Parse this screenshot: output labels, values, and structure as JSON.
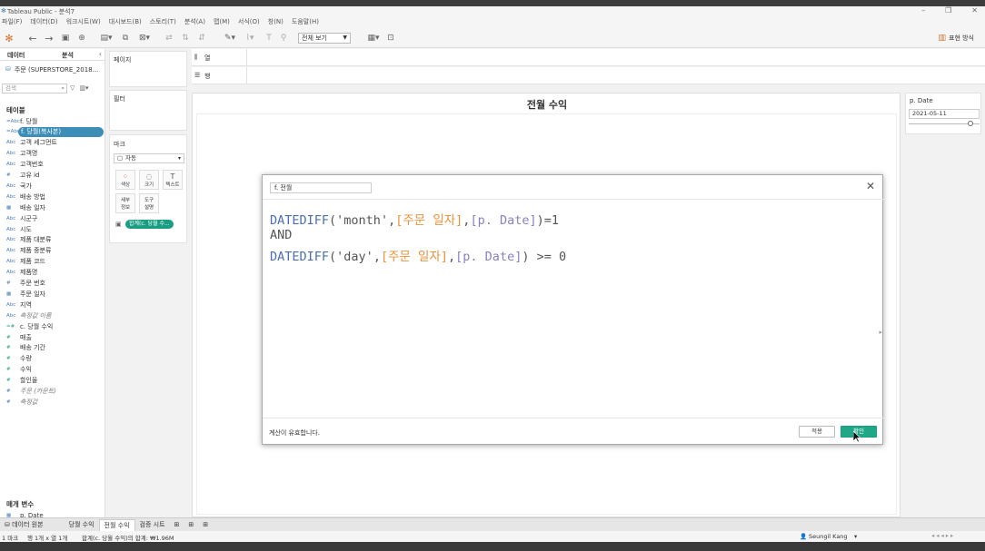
{
  "window": {
    "title": "Tableau Public - 분석7",
    "controls": [
      "–",
      "❐",
      "✕"
    ]
  },
  "menu": [
    "파일(F)",
    "데이터(D)",
    "워크시트(W)",
    "대시보드(B)",
    "스토리(T)",
    "분석(A)",
    "맵(M)",
    "서식(O)",
    "창(N)",
    "도움말(H)"
  ],
  "toolbar": {
    "view_select": "전체 보기",
    "present_label": "표현 방식"
  },
  "left_pane": {
    "tabs": [
      "데이터",
      "분석"
    ],
    "datasource": "주문 (SUPERSTORE_2018...",
    "search_placeholder": "검색",
    "tables_heading": "테이블",
    "fields": [
      {
        "type": "=Abc",
        "label": "f. 당월",
        "kind": "dim"
      },
      {
        "type": "=Abc",
        "label": "f. 당월(복사본)",
        "kind": "highlight"
      },
      {
        "type": "Abc",
        "label": "고객 세그먼트",
        "kind": "dim"
      },
      {
        "type": "Abc",
        "label": "고객명",
        "kind": "dim"
      },
      {
        "type": "Abc",
        "label": "고객번호",
        "kind": "dim"
      },
      {
        "type": "#",
        "label": "고유 id",
        "kind": "dim"
      },
      {
        "type": "Abc",
        "label": "국가",
        "kind": "dim"
      },
      {
        "type": "Abc",
        "label": "배송 방법",
        "kind": "dim"
      },
      {
        "type": "▦",
        "label": "배송 일자",
        "kind": "dim"
      },
      {
        "type": "Abc",
        "label": "시군구",
        "kind": "dim"
      },
      {
        "type": "Abc",
        "label": "시도",
        "kind": "dim"
      },
      {
        "type": "Abc",
        "label": "제품 대분류",
        "kind": "dim"
      },
      {
        "type": "Abc",
        "label": "제품 중분류",
        "kind": "dim"
      },
      {
        "type": "Abc",
        "label": "제품 코드",
        "kind": "dim"
      },
      {
        "type": "Abc",
        "label": "제품명",
        "kind": "dim"
      },
      {
        "type": "#",
        "label": "주문 번호",
        "kind": "dim"
      },
      {
        "type": "▦",
        "label": "주문 일자",
        "kind": "dim"
      },
      {
        "type": "Abc",
        "label": "지역",
        "kind": "dim"
      },
      {
        "type": "Abc",
        "label": "측정값 이름",
        "kind": "ital"
      },
      {
        "type": "=#",
        "label": "c. 당월 수익",
        "kind": "meas"
      },
      {
        "type": "#",
        "label": "매출",
        "kind": "meas"
      },
      {
        "type": "#",
        "label": "배송 기간",
        "kind": "meas"
      },
      {
        "type": "#",
        "label": "수량",
        "kind": "meas"
      },
      {
        "type": "#",
        "label": "수익",
        "kind": "meas"
      },
      {
        "type": "#",
        "label": "할인율",
        "kind": "meas"
      },
      {
        "type": "#",
        "label": "주문 (카운트)",
        "kind": "ital"
      },
      {
        "type": "#",
        "label": "측정값",
        "kind": "ital"
      }
    ],
    "params_heading": "매개 변수",
    "params": [
      {
        "type": "▦",
        "label": "p. Date"
      }
    ]
  },
  "cards": {
    "pages": "페이지",
    "filters": "필터",
    "marks": "마크",
    "marks_type": "자동",
    "mark_buttons": [
      {
        "icon": "⁘",
        "label": "색상"
      },
      {
        "icon": "◌",
        "label": "크기"
      },
      {
        "icon": "T",
        "label": "텍스트"
      },
      {
        "icon": "",
        "label": "세부\n정보"
      },
      {
        "icon": "",
        "label": "도구\n설명"
      }
    ],
    "mark_pill": "합계(c. 당월 수..."
  },
  "shelves": {
    "columns": "열",
    "rows": "행"
  },
  "sheet": {
    "title": "전월 수익"
  },
  "parameter_card": {
    "title": "p. Date",
    "value": "2021-05-11"
  },
  "dialog": {
    "name": "f. 전월",
    "code_lines": [
      [
        [
          "kw",
          "DATEDIFF"
        ],
        [
          "op",
          "("
        ],
        [
          "str",
          "'month'"
        ],
        [
          "op",
          ","
        ],
        [
          "fld",
          "[주문 일자]"
        ],
        [
          "op",
          ","
        ],
        [
          "prm",
          "[p. Date]"
        ],
        [
          "op",
          ")=1"
        ]
      ],
      [
        [
          "op",
          "AND"
        ]
      ],
      [
        [
          "kw",
          "DATEDIFF"
        ],
        [
          "op",
          "("
        ],
        [
          "str",
          "'day'"
        ],
        [
          "op",
          ","
        ],
        [
          "fld",
          "[주문 일자]"
        ],
        [
          "op",
          ","
        ],
        [
          "prm",
          "[p. Date]"
        ],
        [
          "op",
          ") >= 0"
        ]
      ]
    ],
    "status": "계산이 유효합니다.",
    "apply_label": "적용",
    "ok_label": "확인"
  },
  "bottom_tabs": [
    "데이터 원본",
    "당월 수익",
    "전월 수익",
    "검증 시트"
  ],
  "active_tab": "전월 수익",
  "status": {
    "marks": "1 마크",
    "rows": "행 1개 x 열 1개",
    "sum": "합계(c. 당월 수익)의 합계: ₩1.96M",
    "user": "Seungil Kang"
  },
  "colors": {
    "highlight": "#3d8fb8",
    "pill": "#1a9e83",
    "field_orange": "#e8923d",
    "param_purple": "#8a7fc0",
    "keyword_blue": "#4a6fb5"
  }
}
